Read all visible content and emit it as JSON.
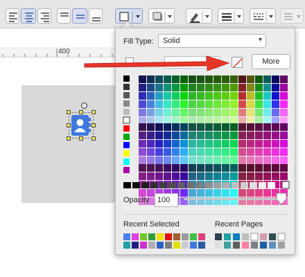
{
  "ruler": {
    "mark_label": "400"
  },
  "popup": {
    "fill_type_label": "Fill Type:",
    "fill_type_value": "Solid",
    "more_label": "More",
    "opacity_label": "Opacity",
    "opacity_value": "100",
    "opacity_fraction": 1.0,
    "recent_selected_label": "Recent Selected",
    "recent_pages_label": "Recent Pages"
  },
  "colors": {
    "accent": "#e8352a",
    "selection_fill": "#3f78e0",
    "left_column": [
      "#000000",
      "#333333",
      "#555555",
      "#888888",
      "#bbbbbb",
      "#ffffff",
      "#ff0000",
      "#00aa00",
      "#0000ff",
      "#ffff00",
      "#00ffff",
      "#aa00aa"
    ],
    "gray_row": [
      "#000000",
      "#0f0f0f",
      "#1f1f1f",
      "#2f2f2f",
      "#3f3f3f",
      "#4f4f4f",
      "#5f5f5f",
      "#6f6f6f",
      "#7f7f7f",
      "#8f8f8f",
      "#9f9f9f",
      "#afafaf",
      "#bfbfbf",
      "#cfcfcf",
      "#dfdfdf",
      "#efefef",
      "#ffffff"
    ],
    "recent_selected": [
      "#4a80e8",
      "#e040e0",
      "#76c828",
      "#2f9d3a",
      "#f0e000",
      "#e01010",
      "#a06030",
      "#9a9a9a",
      "#40c040",
      "#e04080",
      "#20a0a0",
      "#202080",
      "#d030d0",
      "#b0b0b0",
      "#3060c0",
      "#7d7d7d",
      "#e0e000",
      "#cccccc",
      "#3f78e0",
      "#2a5aa0"
    ],
    "recent_pages": [
      "#304050",
      "#20a0a0",
      "#1080c0",
      "#c0c0c0",
      "#ffffff",
      "#d0a0b0",
      "#2f4f4f",
      "#ffffff",
      "#e0e0e0",
      "#40a0a0",
      "#606060",
      "#ff80a0",
      "#808080",
      "#2060a0",
      "#6090c0",
      "#a0a0a0"
    ]
  },
  "icons": [
    "fill-color-icon",
    "shadow-icon",
    "line-color-icon",
    "line-width-icon",
    "line-style-icon",
    "align-left-icon",
    "align-center-icon",
    "align-right-icon",
    "valign-top-icon",
    "valign-middle-icon",
    "valign-bottom-icon",
    "contact-icon",
    "no-fill-icon",
    "red-arrow"
  ]
}
